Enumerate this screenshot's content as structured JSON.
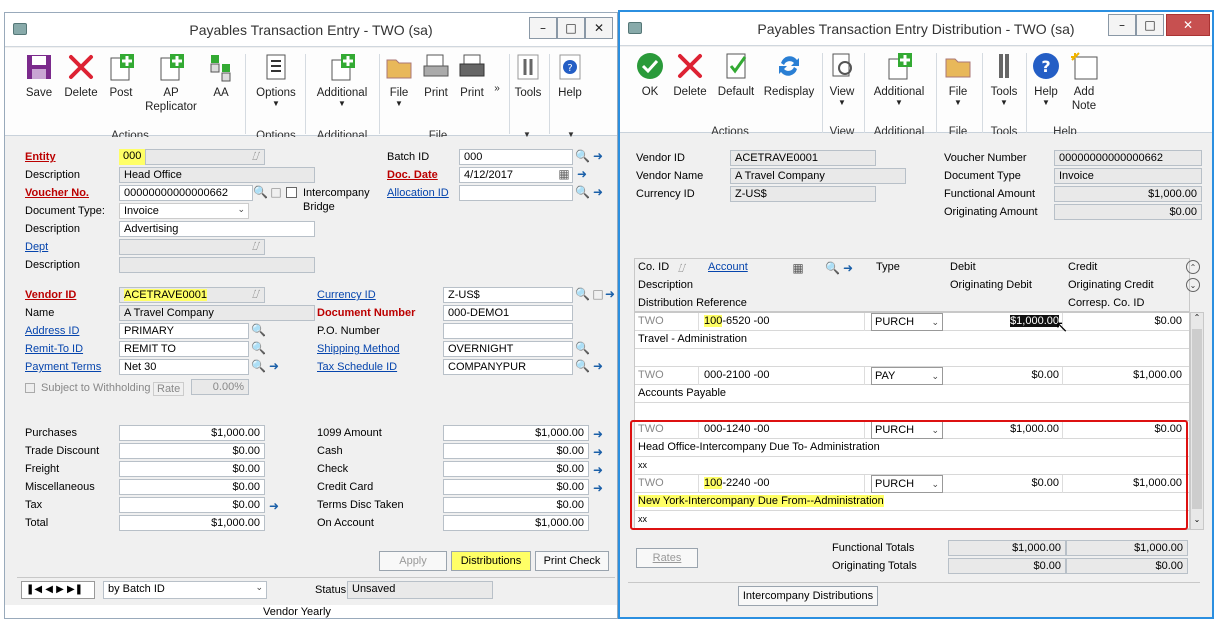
{
  "left": {
    "title": "Payables Transaction Entry  -  TWO (sa)",
    "ribbon": {
      "save": "Save",
      "delete": "Delete",
      "post": "Post",
      "ap_replicator_1": "AP",
      "ap_replicator_2": "Replicator",
      "aa": "AA",
      "options": "Options",
      "additional": "Additional",
      "file": "File",
      "print1": "Print",
      "print2": "Print",
      "tools": "Tools",
      "help": "Help",
      "grp_actions": "Actions",
      "grp_options": "Options",
      "grp_additional": "Additional",
      "grp_file": "File"
    },
    "form": {
      "entity_label": "Entity",
      "entity": "000",
      "desc1_label": "Description",
      "desc1": "Head Office",
      "voucher_label": "Voucher No.",
      "voucher": "00000000000000662",
      "doctype_label": "Document Type:",
      "doctype": "Invoice",
      "desc2_label": "Description",
      "desc2": "Advertising",
      "dept_label": "Dept",
      "desc3_label": "Description",
      "intercompany_1": "Intercompany",
      "intercompany_2": "Bridge",
      "batch_label": "Batch ID",
      "batch": "000",
      "docdate_label": "Doc. Date",
      "docdate": "4/12/2017",
      "allocation_label": "Allocation ID",
      "vendor_label": "Vendor ID",
      "vendor": "ACETRAVE0001",
      "name_label": "Name",
      "name": "A Travel Company",
      "address_label": "Address ID",
      "address": "PRIMARY",
      "remit_label": "Remit-To ID",
      "remit": "REMIT TO",
      "terms_label": "Payment Terms",
      "terms": "Net 30",
      "withholding": "Subject to Withholding",
      "rate_label": "Rate",
      "rate": "0.00%",
      "currency_label": "Currency ID",
      "currency": "Z-US$",
      "docnum_label": "Document Number",
      "docnum": "000-DEMO1",
      "po_label": "P.O. Number",
      "shipping_label": "Shipping Method",
      "shipping": "OVERNIGHT",
      "taxsched_label": "Tax Schedule ID",
      "taxsched": "COMPANYPUR"
    },
    "amounts_left": [
      {
        "label": "Purchases",
        "value": "$1,000.00"
      },
      {
        "label": "Trade Discount",
        "value": "$0.00"
      },
      {
        "label": "Freight",
        "value": "$0.00"
      },
      {
        "label": "Miscellaneous",
        "value": "$0.00"
      },
      {
        "label": "Tax",
        "value": "$0.00"
      },
      {
        "label": "Total",
        "value": "$1,000.00"
      }
    ],
    "amounts_right": [
      {
        "label": "1099 Amount",
        "value": "$1,000.00"
      },
      {
        "label": "Cash",
        "value": "$0.00"
      },
      {
        "label": "Check",
        "value": "$0.00"
      },
      {
        "label": "Credit Card",
        "value": "$0.00"
      },
      {
        "label": "Terms Disc Taken",
        "value": "$0.00"
      },
      {
        "label": "On Account",
        "value": "$1,000.00"
      }
    ],
    "buttons": {
      "apply": "Apply",
      "distributions": "Distributions",
      "print_check": "Print Check"
    },
    "footer": {
      "sort": "by Batch ID",
      "status_label": "Status",
      "status": "Unsaved",
      "below": "Vendor Yearly"
    }
  },
  "right": {
    "title": "Payables Transaction Entry Distribution  -  TWO (sa)",
    "ribbon": {
      "ok": "OK",
      "delete": "Delete",
      "default": "Default",
      "redisplay": "Redisplay",
      "view": "View",
      "additional": "Additional",
      "file": "File",
      "tools": "Tools",
      "help": "Help",
      "addnote_1": "Add",
      "addnote_2": "Note",
      "grp_actions": "Actions",
      "grp_view": "View",
      "grp_additional": "Additional",
      "grp_file": "File",
      "grp_tools": "Tools",
      "grp_help": "Help"
    },
    "header": {
      "vendor_label": "Vendor ID",
      "vendor": "ACETRAVE0001",
      "vname_label": "Vendor Name",
      "vname": "A Travel Company",
      "currency_label": "Currency ID",
      "currency": "Z-US$",
      "voucher_label": "Voucher Number",
      "voucher": "00000000000000662",
      "doctype_label": "Document Type",
      "doctype": "Invoice",
      "func_label": "Functional Amount",
      "func": "$1,000.00",
      "orig_label": "Originating Amount",
      "orig": "$0.00"
    },
    "grid_header": {
      "coid": "Co. ID",
      "account": "Account",
      "type": "Type",
      "debit": "Debit",
      "credit": "Credit",
      "description": "Description",
      "orig_debit": "Originating Debit",
      "orig_credit": "Originating Credit",
      "dist_ref": "Distribution Reference",
      "corresp": "Corresp. Co. ID"
    },
    "rows": [
      {
        "co": "TWO",
        "acct_a": "100",
        "acct_b": "-6520 -00",
        "type": "PURCH",
        "debit": "$1,000.00",
        "credit": "$0.00",
        "desc": "Travel - Administration",
        "ref": ""
      },
      {
        "co": "TWO",
        "acct_a": "000",
        "acct_b": "-2100 -00",
        "type": "PAY",
        "debit": "$0.00",
        "credit": "$1,000.00",
        "desc": "Accounts Payable",
        "ref": ""
      },
      {
        "co": "TWO",
        "acct_a": "000",
        "acct_b": "-1240 -00",
        "type": "PURCH",
        "debit": "$1,000.00",
        "credit": "$0.00",
        "desc": "Head Office-Intercompany Due To- Administration",
        "ref": "xx"
      },
      {
        "co": "TWO",
        "acct_a": "100",
        "acct_b": "-2240 -00",
        "type": "PURCH",
        "debit": "$0.00",
        "credit": "$1,000.00",
        "desc": "New York-Intercompany Due From--Administration",
        "ref": "xx"
      }
    ],
    "totals": {
      "func_label": "Functional Totals",
      "func_debit": "$1,000.00",
      "func_credit": "$1,000.00",
      "orig_label": "Originating Totals",
      "orig_debit": "$0.00",
      "orig_credit": "$0.00"
    },
    "buttons": {
      "rates": "Rates",
      "intercompany": "Intercompany Distributions"
    }
  }
}
